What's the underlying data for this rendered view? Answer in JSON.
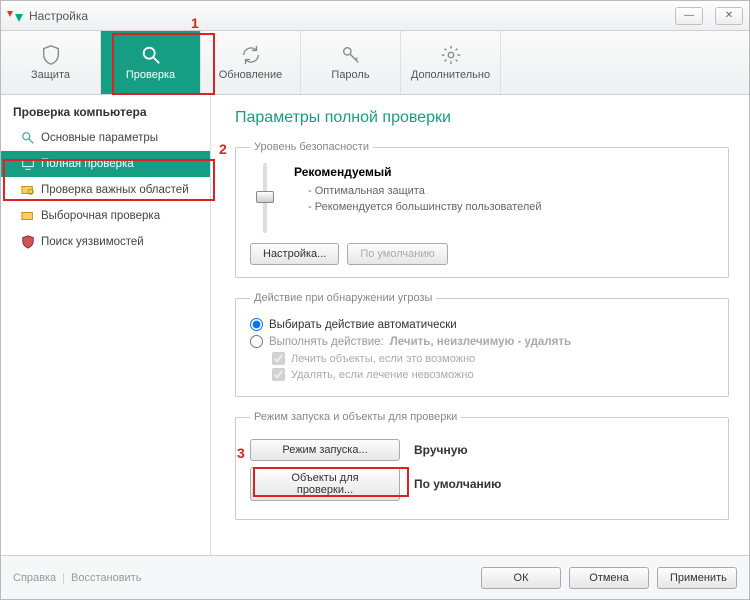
{
  "window": {
    "title": "Настройка"
  },
  "tabs": {
    "protect": "Защита",
    "scan": "Проверка",
    "update": "Обновление",
    "password": "Пароль",
    "more": "Дополнительно"
  },
  "sidebar": {
    "heading": "Проверка компьютера",
    "items": {
      "basic": "Основные параметры",
      "full": "Полная проверка",
      "critical": "Проверка важных областей",
      "custom": "Выборочная проверка",
      "vuln": "Поиск уязвимостей"
    }
  },
  "main": {
    "title": "Параметры полной проверки",
    "security": {
      "legend": "Уровень безопасности",
      "level_name": "Рекомендуемый",
      "b1": "- Оптимальная защита",
      "b2": "- Рекомендуется большинству пользователей",
      "settings_btn": "Настройка...",
      "default_btn": "По умолчанию"
    },
    "action": {
      "legend": "Действие при обнаружении угрозы",
      "r1": "Выбирать действие автоматически",
      "r2_prefix": "Выполнять действие:",
      "r2_value": "Лечить, неизлечимую - удалять",
      "c1": "Лечить объекты, если это возможно",
      "c2": "Удалять, если лечение невозможно"
    },
    "mode": {
      "legend": "Режим запуска и объекты для проверки",
      "run_btn": "Режим запуска...",
      "run_val": "Вручную",
      "obj_btn": "Объекты для проверки...",
      "obj_val": "По умолчанию"
    }
  },
  "footer": {
    "help": "Справка",
    "restore": "Восстановить",
    "ok": "ОК",
    "cancel": "Отмена",
    "apply": "Применить"
  },
  "markers": {
    "m1": "1",
    "m2": "2",
    "m3": "3"
  }
}
